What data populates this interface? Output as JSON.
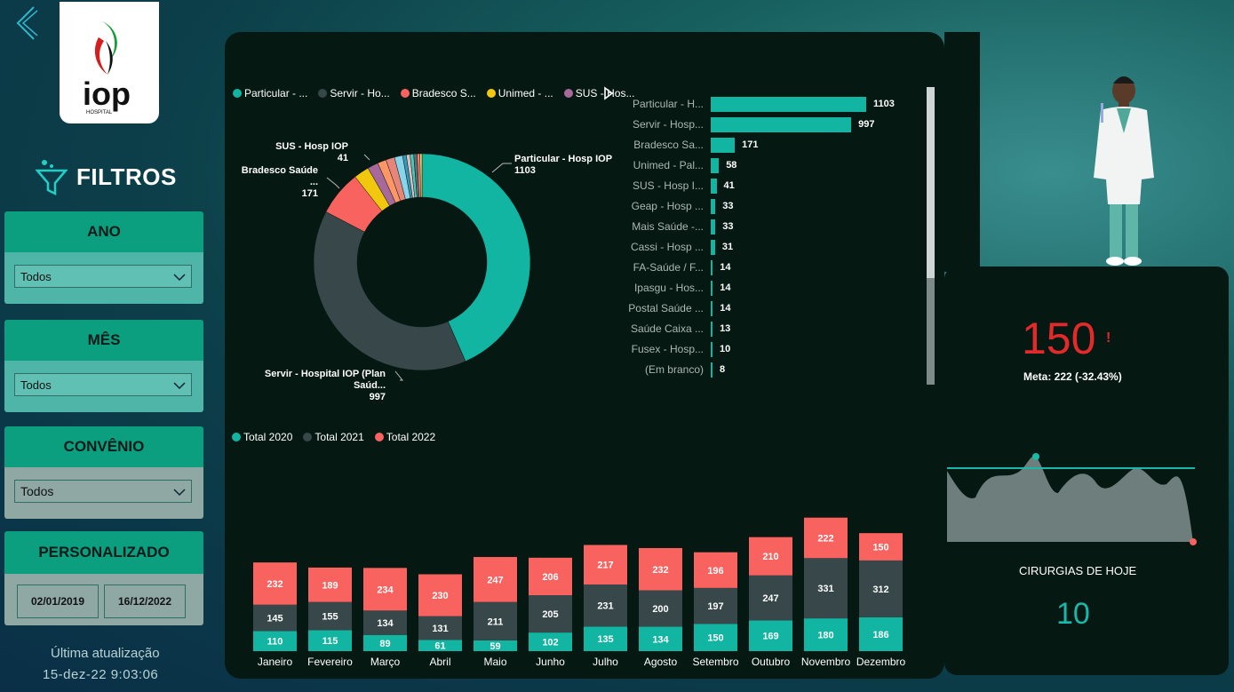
{
  "sidebar": {
    "title": "FILTROS",
    "logo_text": "iop",
    "logo_sub": "HOSPITAL",
    "filters": [
      {
        "label": "ANO",
        "value": "Todos"
      },
      {
        "label": "MÊS",
        "value": "Todos"
      },
      {
        "label": "CONVÊNIO",
        "value": "Todos"
      }
    ],
    "custom": {
      "label": "PERSONALIZADO",
      "start": "02/01/2019",
      "end": "16/12/2022"
    },
    "updated_label": "Última atualização",
    "updated_value": "15-dez-22 9:03:06"
  },
  "colors": {
    "teal": "#12b5a2",
    "dark": "#37474a",
    "red": "#f8625f",
    "yellow": "#f2c80f",
    "purple": "#a66999"
  },
  "donut": {
    "legend": [
      {
        "label": "Particular - ...",
        "color": "#12b5a2"
      },
      {
        "label": "Servir - Ho...",
        "color": "#37474a"
      },
      {
        "label": "Bradesco S...",
        "color": "#f8625f"
      },
      {
        "label": "Unimed - ...",
        "color": "#f2c80f"
      },
      {
        "label": "SUS - Hos...",
        "color": "#a66999"
      }
    ],
    "labels": [
      {
        "name": "Particular - Hosp IOP",
        "value": "1103"
      },
      {
        "name": "Servir - Hospital IOP (Plan Saúd...",
        "value": "997"
      },
      {
        "name": "Bradesco Saúde ...",
        "value": "171"
      },
      {
        "name": "SUS - Hosp IOP",
        "value": "41"
      }
    ]
  },
  "kpi": {
    "value": "150",
    "alert": "!",
    "meta": "Meta: 222 (-32.43%)"
  },
  "cirurgias": {
    "label": "CIRURGIAS DE HOJE",
    "value": "10"
  },
  "chart_data": [
    {
      "type": "pie",
      "categories": [
        "Particular - Hosp IOP",
        "Servir - Hospital IOP (Plan Saúd...",
        "Bradesco Saúde ...",
        "Unimed - Pal...",
        "SUS - Hosp IOP",
        "Geap - Hosp ...",
        "Mais Saúde -...",
        "Cassi - Hosp ...",
        "FA-Saúde / F...",
        "Ipasgu - Hos...",
        "Postal Saúde ...",
        "Saúde Caixa ...",
        "Fusex - Hosp...",
        "(Em branco)"
      ],
      "values": [
        1103,
        997,
        171,
        58,
        41,
        33,
        33,
        31,
        14,
        14,
        14,
        13,
        10,
        8
      ]
    },
    {
      "type": "bar",
      "orientation": "horizontal",
      "categories": [
        "Particular - H...",
        "Servir - Hosp...",
        "Bradesco Sa...",
        "Unimed - Pal...",
        "SUS - Hosp I...",
        "Geap - Hosp ...",
        "Mais Saúde -...",
        "Cassi - Hosp ...",
        "FA-Saúde / F...",
        "Ipasgu - Hos...",
        "Postal Saúde ...",
        "Saúde Caixa ...",
        "Fusex - Hosp...",
        "(Em branco)"
      ],
      "values": [
        1103,
        997,
        171,
        58,
        41,
        33,
        33,
        31,
        14,
        14,
        14,
        13,
        10,
        8
      ]
    },
    {
      "type": "bar",
      "stacked": true,
      "categories": [
        "Janeiro",
        "Fevereiro",
        "Março",
        "Abril",
        "Maio",
        "Junho",
        "Julho",
        "Agosto",
        "Setembro",
        "Outubro",
        "Novembro",
        "Dezembro"
      ],
      "series": [
        {
          "name": "Total 2020",
          "color": "#12b5a2",
          "values": [
            110,
            115,
            89,
            61,
            59,
            102,
            135,
            134,
            150,
            169,
            180,
            186
          ]
        },
        {
          "name": "Total 2021",
          "color": "#37474a",
          "values": [
            145,
            155,
            134,
            131,
            211,
            205,
            231,
            200,
            197,
            247,
            331,
            312
          ]
        },
        {
          "name": "Total 2022",
          "color": "#f8625f",
          "values": [
            232,
            189,
            234,
            230,
            247,
            206,
            217,
            232,
            196,
            210,
            222,
            150
          ]
        }
      ],
      "legend_position": "top-left"
    }
  ]
}
